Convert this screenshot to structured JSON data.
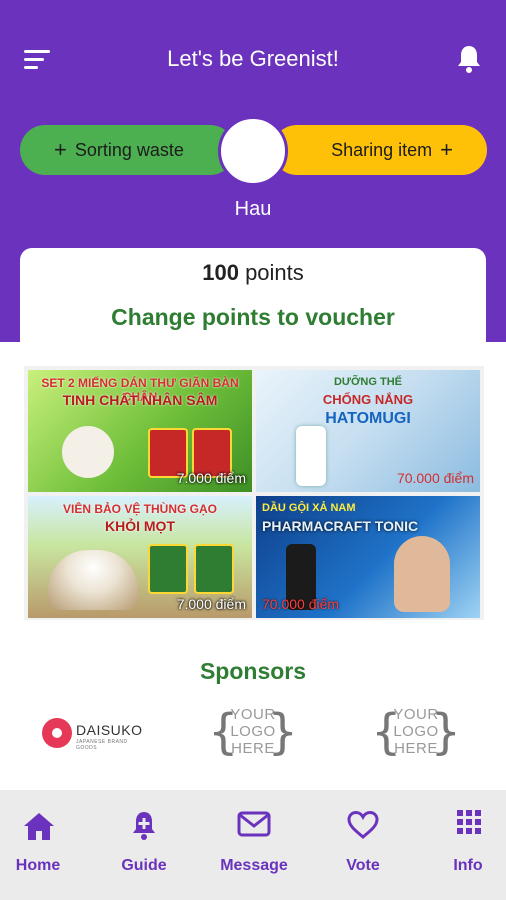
{
  "header": {
    "title": "Let's be Greenist!",
    "menu_icon": "menu-icon",
    "notification_icon": "bell-icon",
    "background": "#6a32bd"
  },
  "profile": {
    "username": "Hau",
    "left_action": {
      "label": "Sorting waste",
      "plus": "+",
      "color": "#4caf50"
    },
    "right_action": {
      "label": "Sharing item",
      "plus": "+",
      "color": "#ffc107"
    }
  },
  "points_card": {
    "amount": "100",
    "unit": "points",
    "heading": "Change points to voucher"
  },
  "vouchers": [
    {
      "line1": "SET 2 MIẾNG DÁN THƯ GIÃN BÀN CHÂN",
      "line2": "TINH CHẤT NHÂN SÂM",
      "price": "7.000 điểm"
    },
    {
      "line1": "DƯỠNG THỂ",
      "line2": "CHỐNG NẮNG",
      "line3": "HATOMUGI",
      "price": "70.000 điểm"
    },
    {
      "line1": "VIÊN BẢO VỆ THÙNG GẠO",
      "line2": "KHỎI MỌT",
      "price": "7.000 điểm"
    },
    {
      "line1": "DẦU GỘI XẢ NAM",
      "line2": "PHARMACRAFT TONIC",
      "price": "70.000 điểm"
    }
  ],
  "sponsors": {
    "heading": "Sponsors",
    "items": [
      {
        "name": "DAISUKO",
        "tagline": "JAPANESE BRAND GOODS"
      },
      {
        "text": "YOUR LOGO HERE"
      },
      {
        "text": "YOUR LOGO HERE"
      }
    ]
  },
  "bottom_nav": {
    "items": [
      {
        "label": "Home",
        "icon": "home-icon"
      },
      {
        "label": "Guide",
        "icon": "guide-icon"
      },
      {
        "label": "Message",
        "icon": "mail-icon"
      },
      {
        "label": "Vote",
        "icon": "heart-icon"
      },
      {
        "label": "Info",
        "icon": "grid-icon"
      }
    ],
    "accent": "#6a32bd"
  }
}
